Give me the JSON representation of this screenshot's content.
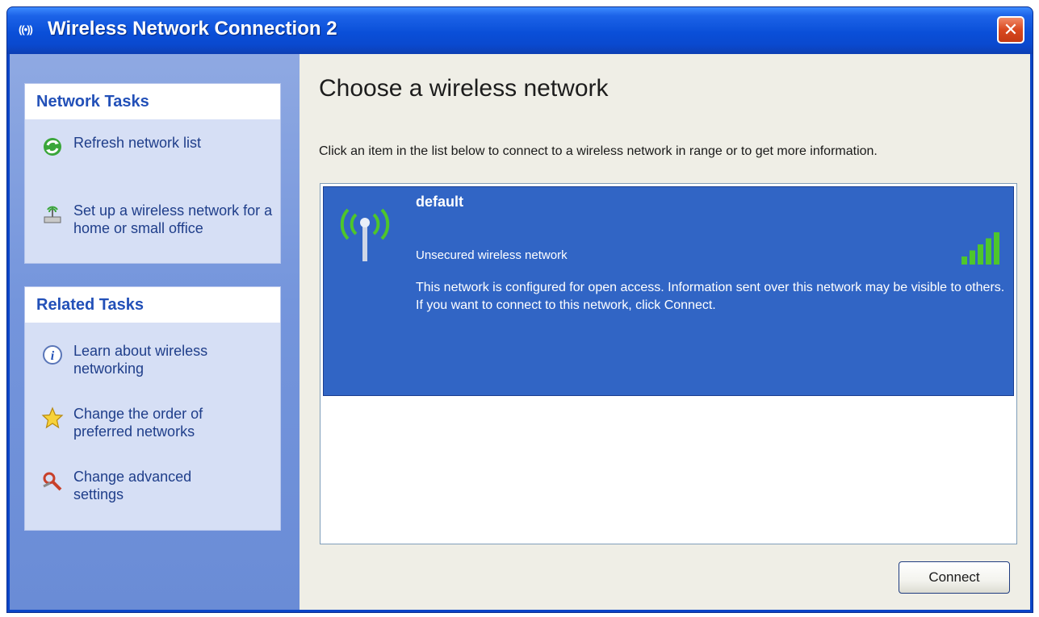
{
  "window": {
    "title": "Wireless Network Connection 2",
    "title_icon": "((•))",
    "close_glyph": "✕"
  },
  "sidebar": {
    "network_tasks": {
      "title": "Network Tasks",
      "items": [
        {
          "label": "Refresh network list",
          "icon": "refresh-icon"
        },
        {
          "label": "Set up a wireless network for a home or small office",
          "icon": "wireless-setup-icon"
        }
      ]
    },
    "related_tasks": {
      "title": "Related Tasks",
      "items": [
        {
          "label": "Learn about wireless networking",
          "icon": "info-icon"
        },
        {
          "label": "Change the order of preferred networks",
          "icon": "star-icon"
        },
        {
          "label": "Change advanced settings",
          "icon": "settings-icon"
        }
      ]
    }
  },
  "main": {
    "heading": "Choose a wireless network",
    "instruction": "Click an item in the list below to connect to a wireless network in range or to get more information.",
    "networks": [
      {
        "name": "default",
        "security": "Unsecured wireless network",
        "description": "This network is configured for open access. Information sent over this network may be visible to others. If you want to connect to this network, click Connect.",
        "signal_bars": 5,
        "signal_max": 5
      }
    ],
    "connect_label": "Connect"
  },
  "colors": {
    "titlebar": "#0a4fd8",
    "sidebar_bg": "#7495dc",
    "panel_bg": "#d6dff5",
    "panel_title": "#2250b8",
    "selected_item": "#3165c5",
    "signal_green": "#4ec62c"
  }
}
